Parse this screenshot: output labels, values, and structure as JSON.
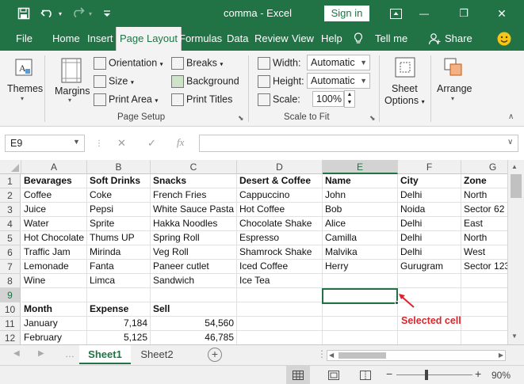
{
  "title_bar": {
    "document_title": "comma  -  Excel",
    "sign_in_label": "Sign in",
    "minimize_symbol": "—",
    "restore_symbol": "❐",
    "close_symbol": "✕"
  },
  "tabs": [
    {
      "label": "File"
    },
    {
      "label": "Home"
    },
    {
      "label": "Insert"
    },
    {
      "label": "Page Layout",
      "active": true
    },
    {
      "label": "Formulas"
    },
    {
      "label": "Data"
    },
    {
      "label": "Review"
    },
    {
      "label": "View"
    },
    {
      "label": "Help"
    },
    {
      "label": "Tell me"
    },
    {
      "label": "Share"
    }
  ],
  "ribbon": {
    "themes_label": "Themes",
    "margins_label": "Margins",
    "orientation_label": "Orientation",
    "size_label": "Size",
    "print_area_label": "Print Area",
    "breaks_label": "Breaks",
    "background_label": "Background",
    "print_titles_label": "Print Titles",
    "page_setup_group": "Page Setup",
    "width_label": "Width:",
    "width_value": "Automatic",
    "height_label": "Height:",
    "height_value": "Automatic",
    "scale_label": "Scale:",
    "scale_value": "100%",
    "scale_to_fit_group": "Scale to Fit",
    "sheet_options_label_1": "Sheet",
    "sheet_options_label_2": "Options",
    "arrange_label": "Arrange"
  },
  "formula_bar": {
    "name_box": "E9",
    "cancel_symbol": "✕",
    "enter_symbol": "✓",
    "fx_symbol": "fx",
    "formula": ""
  },
  "columns": [
    "A",
    "B",
    "C",
    "D",
    "E",
    "F",
    "G"
  ],
  "rows": [
    "1",
    "2",
    "3",
    "4",
    "5",
    "6",
    "7",
    "8",
    "9",
    "10",
    "11",
    "12"
  ],
  "selected_column": "E",
  "selected_row": "9",
  "cells": {
    "r1": [
      "Bevarages",
      "Soft Drinks",
      "Snacks",
      "Desert & Coffee",
      "Name",
      "City",
      "Zone"
    ],
    "r2": [
      "Coffee",
      "Coke",
      "French Fries",
      "Cappuccino",
      "John",
      "Delhi",
      "North"
    ],
    "r3": [
      "Juice",
      "Pepsi",
      "White Sauce Pasta",
      "Hot Coffee",
      "Bob",
      "Noida",
      "Sector 62"
    ],
    "r4": [
      "Water",
      "Sprite",
      "Hakka Noodles",
      "Chocolate Shake",
      "Alice",
      "Delhi",
      "East"
    ],
    "r5": [
      "Hot Chocolate",
      "Thums UP",
      "Spring Roll",
      "Espresso",
      "Camilla",
      "Delhi",
      "North"
    ],
    "r6": [
      "Traffic Jam",
      "Mirinda",
      "Veg Roll",
      "Shamrock Shake",
      "Malvika",
      "Delhi",
      "West"
    ],
    "r7": [
      "Lemonade",
      "Fanta",
      "Paneer cutlet",
      "Iced Coffee",
      "Herry",
      "Gurugram",
      "Sector 123"
    ],
    "r8": [
      "Wine",
      "Limca",
      "Sandwich",
      "Ice Tea",
      "",
      "",
      ""
    ],
    "r9": [
      "",
      "",
      "",
      "",
      "",
      "",
      ""
    ],
    "r10": [
      "Month",
      "Expense",
      "Sell",
      "",
      "",
      "",
      ""
    ],
    "r11": [
      "January",
      "7,184",
      "54,560",
      "",
      "",
      "",
      ""
    ],
    "r12": [
      "February",
      "5,125",
      "46,785",
      "",
      "",
      "",
      ""
    ]
  },
  "annotation": "Selected cell",
  "sheets": [
    {
      "label": "Sheet1",
      "active": true
    },
    {
      "label": "Sheet2",
      "active": false
    }
  ],
  "status_bar": {
    "zoom": "90%",
    "zoom_out_symbol": "−",
    "zoom_in_symbol": "+"
  },
  "colors": {
    "accent": "#217346",
    "annotation": "#d9262c"
  }
}
